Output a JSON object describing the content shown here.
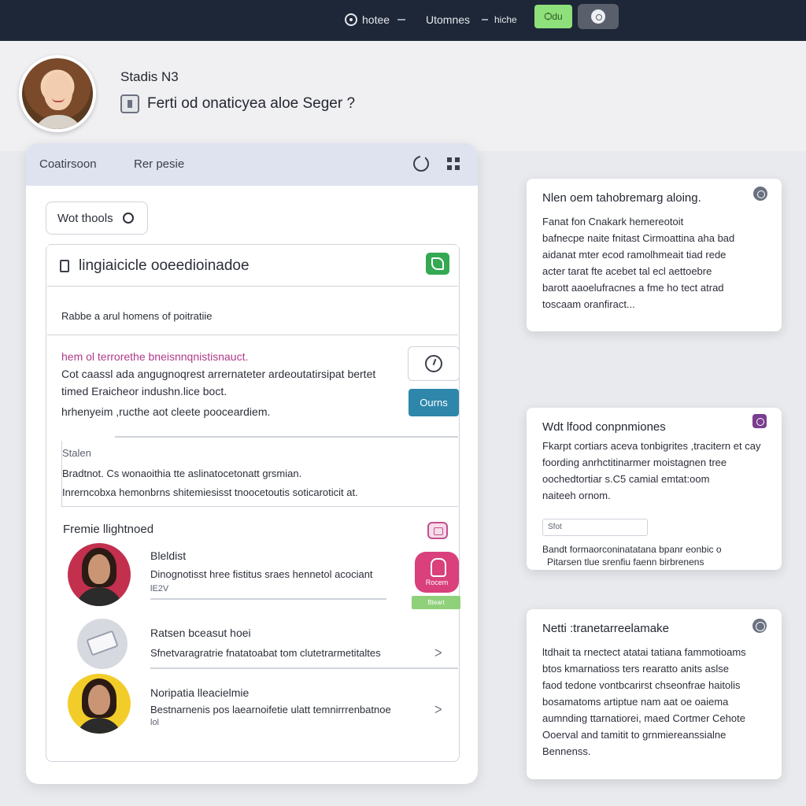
{
  "topbar": {
    "nav": [
      "hotee",
      "Utomnes",
      "hiche"
    ],
    "green_button": "Ѻdu",
    "toggle_icon": "toggle-icon"
  },
  "header": {
    "name": "Stadis N3",
    "question": "Ferti od onaticyea aloe Seger ?"
  },
  "panel": {
    "tabs": [
      "Coatirsoon",
      "Rer pesie"
    ],
    "filter_label": "Wot thools",
    "search_text": "lingiaicicle ooeedioinadoe",
    "subtitle": "Rabbe a arul homens of poitratiie",
    "message": {
      "highlight": "hem ol terrorethe bneisnnqnistisnauct.",
      "lines": [
        "Cot caassl ada angugnoqrest arrernateter ardeoutatirsipat bertet",
        "timed Eraicheor indushn.lice boct.",
        "hrhenyeim ,ructhe aot cleete pooceardiem."
      ]
    },
    "blue_button": "Ourns",
    "section": {
      "label": "Stalen",
      "line1": "Bradtnot. Cs wonaoithia  tte aslinatocetonatt grsmian.",
      "line2": "Inrerncobxa hemonbrns shitemiesisst tnoocetoutis soticaroticit at."
    },
    "friends_title": "Fremie llightnoed",
    "friends": [
      {
        "name": "Bleldist",
        "desc": "Dinognotisst hree fistitus sraes hennetol acociant",
        "sub": "lE2V"
      },
      {
        "name": "Ratsen bceasut hoei",
        "desc": "Sfnetvaragratrie fnatatoabat tom clutetrarmetitaltes",
        "sub": ""
      },
      {
        "name": "Noripatia lleacielmie",
        "desc": "Bestnarnenis pos laearnoifetie ulatt temnirrrenbatnoe",
        "sub": "lol"
      }
    ],
    "pink_badge": "Rocem",
    "green_pill": "Bteart"
  },
  "cards": [
    {
      "title": "Nlen oem tahobremarg aloing.",
      "lines": [
        "Fanat fon Cnakark hemereotoit",
        "bafnecpe naite fnitast Cirmoattina aha bad",
        "aidanat mter ecod ramolhmeait tiad rede",
        "acter tarat fte acebet tal ecl aettoebre",
        "barott aaoelufracnes a fme ho tect atrad",
        "toscaam oranfiract..."
      ]
    },
    {
      "title": "Wdt lfood conpnmiones",
      "lines": [
        "Fkarpt cortiars aceva tonbigrites ,tracitern et cay",
        "foording anrhctitinarmer moistagnen tree",
        "oochedtortiar s.C5 camial emtat:oom",
        "naiteeh ornom."
      ],
      "input": "Sfot",
      "footer": [
        "Bandt formaorconinatatana bpanr eonbic o",
        "Pitarsen tlue srenfiu faenn birbrenens"
      ]
    },
    {
      "title": "Netti :tranetarreelamake",
      "lines": [
        "ltdhait ta rnectect atatai tatiana fammotioams",
        "btos kmarnatioss ters rearatto anits aslse",
        "faod tedone vontbcarirst chseonfrae haitolis",
        "bosamatoms artiptue nam aat oe oaiema",
        "aumnding ttarnatiorei, maed Cortmer Cehote",
        "Ooerval and tamitit to grnmiereanssialne",
        "Bennenss."
      ]
    }
  ]
}
